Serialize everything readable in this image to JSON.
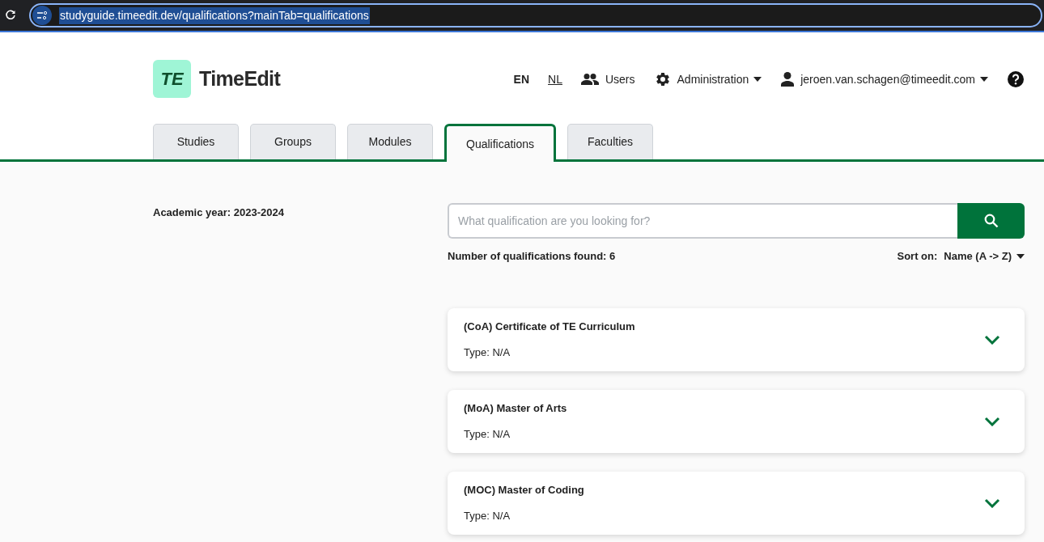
{
  "browser": {
    "url": "studyguide.timeedit.dev/qualifications?mainTab=qualifications"
  },
  "header": {
    "logo_mark": "TE",
    "brand": "TimeEdit",
    "languages": [
      {
        "label": "EN",
        "selected": true
      },
      {
        "label": "NL",
        "selected": false
      }
    ],
    "nav": [
      {
        "kind": "users",
        "label": "Users",
        "dropdown": false
      },
      {
        "kind": "admin",
        "label": "Administration",
        "dropdown": true
      },
      {
        "kind": "user",
        "label": "jeroen.van.schagen@timeedit.com",
        "dropdown": true
      }
    ]
  },
  "tabs": [
    {
      "label": "Studies",
      "selected": false
    },
    {
      "label": "Groups",
      "selected": false
    },
    {
      "label": "Modules",
      "selected": false
    },
    {
      "label": "Qualifications",
      "selected": true
    },
    {
      "label": "Faculties",
      "selected": false
    }
  ],
  "academic_year": "Academic year: 2023-2024",
  "search": {
    "placeholder": "What qualification are you looking for?"
  },
  "results_count": "Number of qualifications found: 6",
  "sort": {
    "label": "Sort on:",
    "value": "Name (A -> Z)"
  },
  "qualifications": [
    {
      "title": "(CoA) Certificate of TE Curriculum",
      "type": "Type: N/A",
      "expanded": false
    },
    {
      "title": "(MoA) Master of Arts",
      "type": "Type: N/A",
      "expanded": false
    },
    {
      "title": "(MOC) Master of Coding",
      "type": "Type: N/A",
      "expanded": false
    }
  ]
}
